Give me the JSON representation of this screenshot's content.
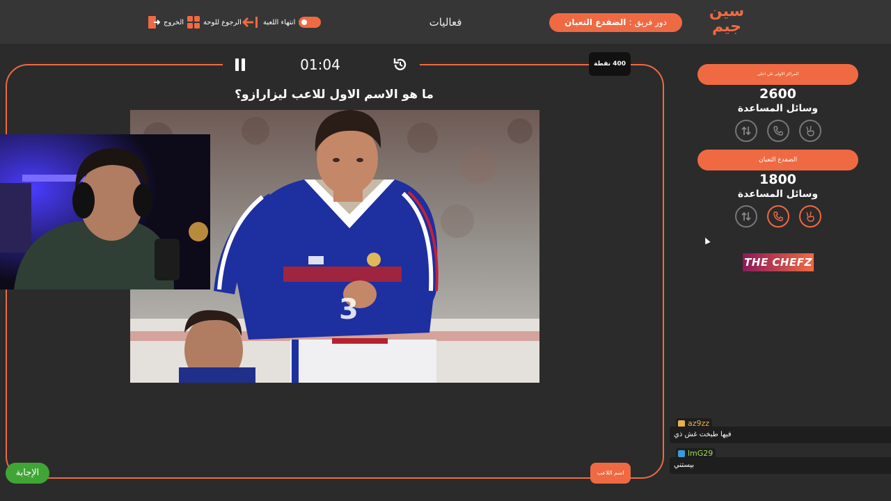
{
  "header": {
    "logo_top": "سين",
    "logo_bottom": "جيم",
    "team_turn_label": "دور فريق :",
    "team_turn_name": "الضفدع التعبان",
    "category_title": "فعاليات",
    "nav": {
      "end_game": "انتهاء اللعبة",
      "back_to_board": "الرجوع للوحة",
      "exit": "الخروج"
    }
  },
  "timer": {
    "time": "01:04"
  },
  "question": {
    "points": "400 نقطة",
    "text": "ما هو الاسم الاول للاعب ليزارازو؟",
    "answer_button": "الإجابة",
    "player_name_button": "اسم اللاعب"
  },
  "teams": [
    {
      "name": "المراكز الاولى تلي اعلى",
      "score": "2600",
      "helps_label": "وسائل المساعدة",
      "helps": [
        {
          "icon": "swap-icon",
          "active": false
        },
        {
          "icon": "phone-icon",
          "active": false
        },
        {
          "icon": "peace-hand-icon",
          "active": false
        }
      ]
    },
    {
      "name": "الضفدع التعبان",
      "score": "1800",
      "helps_label": "وسائل المساعدة",
      "helps": [
        {
          "icon": "swap-icon",
          "active": false
        },
        {
          "icon": "phone-icon",
          "active": true
        },
        {
          "icon": "peace-hand-icon",
          "active": true
        }
      ]
    }
  ],
  "sponsor": "THE CHEFZ",
  "chat": [
    {
      "user": "az9zz",
      "user_color": "#e8b04a",
      "message": "فيها طبخت غش ذي"
    },
    {
      "user": "lmG29",
      "user_color": "#9ee04a",
      "message": "بيستني"
    }
  ],
  "colors": {
    "accent": "#ef6a42",
    "background": "#2b2b2b",
    "answer_green": "#3fa535"
  }
}
